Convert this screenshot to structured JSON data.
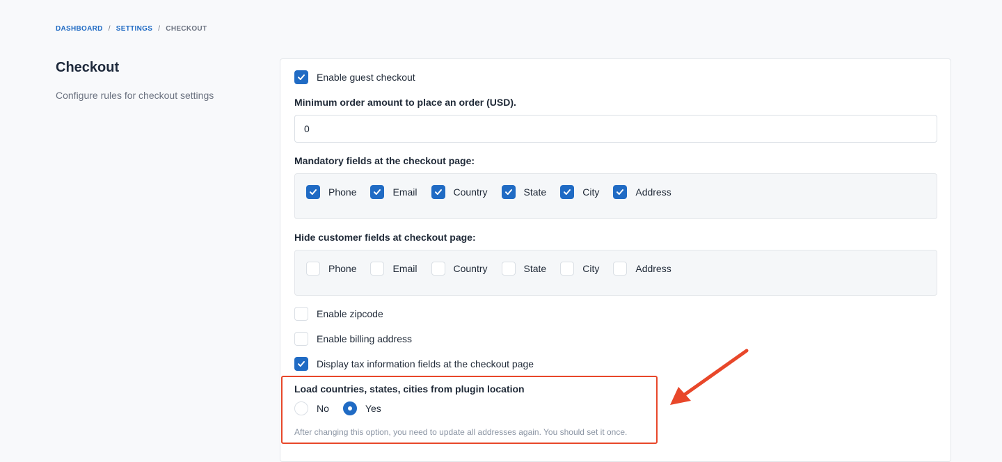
{
  "breadcrumb": {
    "items": [
      "DASHBOARD",
      "SETTINGS",
      "CHECKOUT"
    ],
    "separator": "/"
  },
  "side": {
    "title": "Checkout",
    "description": "Configure rules for checkout settings"
  },
  "form": {
    "guest_checkout": {
      "label": "Enable guest checkout",
      "checked": true
    },
    "min_order": {
      "label": "Minimum order amount to place an order (USD).",
      "value": "0"
    },
    "mandatory": {
      "label": "Mandatory fields at the checkout page:",
      "options": [
        "Phone",
        "Email",
        "Country",
        "State",
        "City",
        "Address"
      ],
      "checked": [
        true,
        true,
        true,
        true,
        true,
        true
      ]
    },
    "hide": {
      "label": "Hide customer fields at checkout page:",
      "options": [
        "Phone",
        "Email",
        "Country",
        "State",
        "City",
        "Address"
      ],
      "checked": [
        false,
        false,
        false,
        false,
        false,
        false
      ]
    },
    "zipcode": {
      "label": "Enable zipcode",
      "checked": false
    },
    "billing": {
      "label": "Enable billing address",
      "checked": false
    },
    "tax": {
      "label": "Display tax information fields at the checkout page",
      "checked": true
    },
    "plugin_location": {
      "label": "Load countries, states, cities from plugin location",
      "options": [
        "No",
        "Yes"
      ],
      "selected": "Yes",
      "help": "After changing this option, you need to update all addresses again. You should set it once."
    }
  },
  "colors": {
    "accent": "#206bc4",
    "highlight": "#e8472a"
  },
  "icons": {
    "checkbox_checked": "checkmark-icon",
    "annotation": "arrow-icon"
  }
}
